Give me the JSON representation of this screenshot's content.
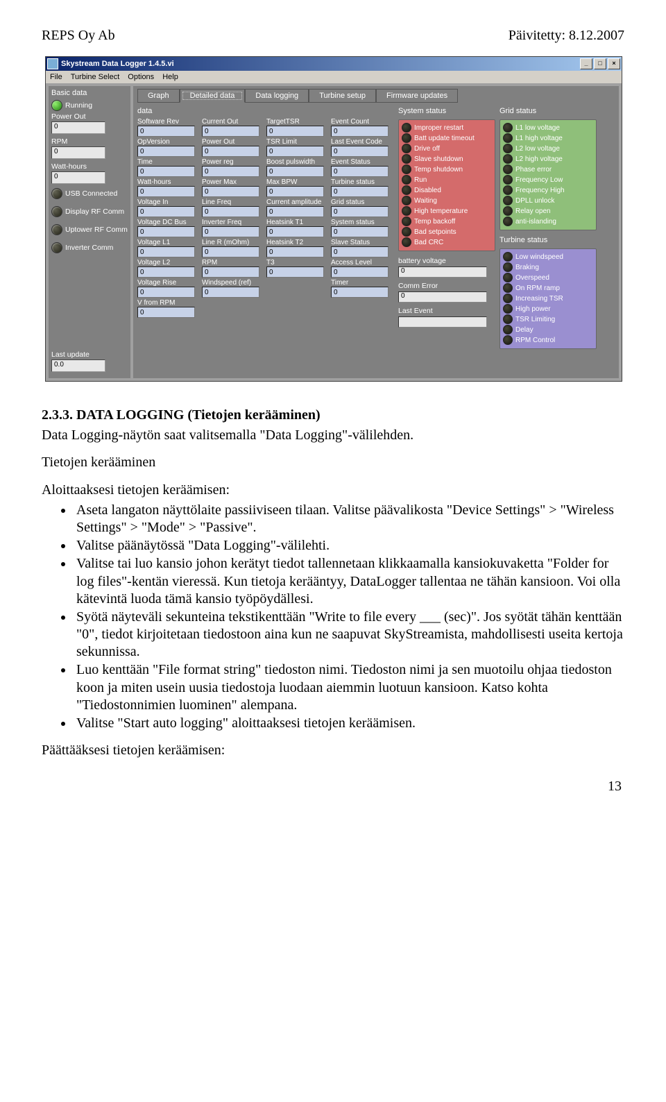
{
  "header": {
    "left": "REPS Oy Ab",
    "right": "Päivitetty: 8.12.2007"
  },
  "app": {
    "title": "Skystream Data Logger 1.4.5.vi",
    "menu": [
      "File",
      "Turbine Select",
      "Options",
      "Help"
    ],
    "win_min": "_",
    "win_max": "□",
    "win_close": "×",
    "sidebar": {
      "title": "Basic data",
      "running_label": "Running",
      "power_out_label": "Power Out",
      "power_out": "0",
      "rpm_label": "RPM",
      "rpm": "0",
      "watt_hours_label": "Watt-hours",
      "watt_hours": "0",
      "usb_label": "USB Connected",
      "display_rf_label": "Display RF Comm",
      "uptower_rf_label": "Uptower RF Comm",
      "inv_comm_label": "Inverter Comm",
      "last_update_label": "Last update",
      "last_update": "0.0"
    },
    "tabs": [
      "Graph",
      "Detailed data",
      "Data logging",
      "Turbine setup",
      "Firmware updates"
    ],
    "data_title": "data",
    "columns": {
      "c1": [
        {
          "l": "Software Rev",
          "v": "0"
        },
        {
          "l": "OpVersion",
          "v": "0"
        },
        {
          "l": "Time",
          "v": "0"
        },
        {
          "l": "Watt-hours",
          "v": "0"
        },
        {
          "l": "Voltage In",
          "v": "0"
        },
        {
          "l": "Voltage DC Bus",
          "v": "0"
        },
        {
          "l": "Voltage L1",
          "v": "0"
        },
        {
          "l": "Voltage L2",
          "v": "0"
        },
        {
          "l": "Voltage Rise",
          "v": "0"
        },
        {
          "l": "V from RPM",
          "v": "0"
        }
      ],
      "c2": [
        {
          "l": "Current Out",
          "v": "0"
        },
        {
          "l": "Power Out",
          "v": "0"
        },
        {
          "l": "Power reg",
          "v": "0"
        },
        {
          "l": "Power Max",
          "v": "0"
        },
        {
          "l": "Line Freq",
          "v": "0"
        },
        {
          "l": "Inverter Freq",
          "v": "0"
        },
        {
          "l": "Line R (mOhm)",
          "v": "0"
        },
        {
          "l": "RPM",
          "v": "0"
        },
        {
          "l": "Windspeed (ref)",
          "v": "0"
        }
      ],
      "c3": [
        {
          "l": "TargetTSR",
          "v": "0"
        },
        {
          "l": "TSR Limit",
          "v": "0"
        },
        {
          "l": "Boost pulswidth",
          "v": "0"
        },
        {
          "l": "Max BPW",
          "v": "0"
        },
        {
          "l": "Current amplitude",
          "v": "0"
        },
        {
          "l": "Heatsink T1",
          "v": "0"
        },
        {
          "l": "Heatsink T2",
          "v": "0"
        },
        {
          "l": "T3",
          "v": "0"
        }
      ],
      "c4": [
        {
          "l": "Event Count",
          "v": "0"
        },
        {
          "l": "Last Event Code",
          "v": "0"
        },
        {
          "l": "Event Status",
          "v": "0"
        },
        {
          "l": "Turbine status",
          "v": "0"
        },
        {
          "l": "Grid status",
          "v": "0"
        },
        {
          "l": "System status",
          "v": "0"
        },
        {
          "l": "Slave Status",
          "v": "0"
        },
        {
          "l": "Access Level",
          "v": "0"
        },
        {
          "l": "Timer",
          "v": "0"
        }
      ]
    },
    "sys_title": "System status",
    "sys_items": [
      "Improper restart",
      "Batt update timeout",
      "Drive off",
      "Slave shutdown",
      "Temp shutdown",
      "Run",
      "Disabled",
      "Waiting",
      "High temperature",
      "Temp backoff",
      "Bad setpoints",
      "Bad CRC"
    ],
    "grid_title": "Grid status",
    "grid_items": [
      "L1 low voltage",
      "L1 high voltage",
      "L2 low voltage",
      "L2 high voltage",
      "Phase error",
      "Frequency Low",
      "Frequency High",
      "DPLL unlock",
      "Relay open",
      "anti-islanding"
    ],
    "turb_title": "Turbine status",
    "turb_items": [
      "Low windspeed",
      "Braking",
      "Overspeed",
      "On RPM ramp",
      "Increasing TSR",
      "High power",
      "TSR Limiting",
      "Delay",
      "RPM Control"
    ],
    "batt_label": "battery voltage",
    "batt_val": "0",
    "comm_err_label": "Comm Error",
    "comm_err_val": "0",
    "last_evt_label": "Last Event",
    "last_evt_val": ""
  },
  "doc": {
    "heading": "2.3.3. DATA LOGGING (Tietojen kerääminen)",
    "p1": "Data Logging-näytön saat valitsemalla \"Data Logging\"-välilehden.",
    "p2": "Tietojen kerääminen",
    "p3": "Aloittaaksesi tietojen keräämisen:",
    "bullets": [
      "Aseta langaton näyttölaite passiiviseen tilaan. Valitse päävalikosta \"Device Settings\" > \"Wireless Settings\" > \"Mode\" > \"Passive\".",
      "Valitse päänäytössä \"Data Logging\"-välilehti.",
      "Valitse tai luo kansio johon kerätyt tiedot tallennetaan klikkaamalla kansiokuvaketta \"Folder for log files\"-kentän vieressä. Kun tietoja kerääntyy, DataLogger tallentaa ne tähän kansioon. Voi olla kätevintä luoda tämä kansio työpöydällesi.",
      "Syötä näyteväli sekunteina tekstikenttään \"Write to file every ___ (sec)\". Jos syötät tähän kenttään \"0\", tiedot kirjoitetaan tiedostoon aina kun ne saapuvat SkyStreamista, mahdollisesti useita kertoja sekunnissa.",
      "Luo kenttään \"File format string\" tiedoston nimi. Tiedoston nimi ja sen muotoilu ohjaa tiedoston koon ja miten usein uusia tiedostoja luodaan aiemmin luotuun kansioon. Katso kohta \"Tiedostonnimien luominen\" alempana.",
      "Valitse \"Start auto logging\" aloittaaksesi tietojen keräämisen."
    ],
    "p4": "Päättääksesi tietojen keräämisen:",
    "pagenum": "13"
  }
}
